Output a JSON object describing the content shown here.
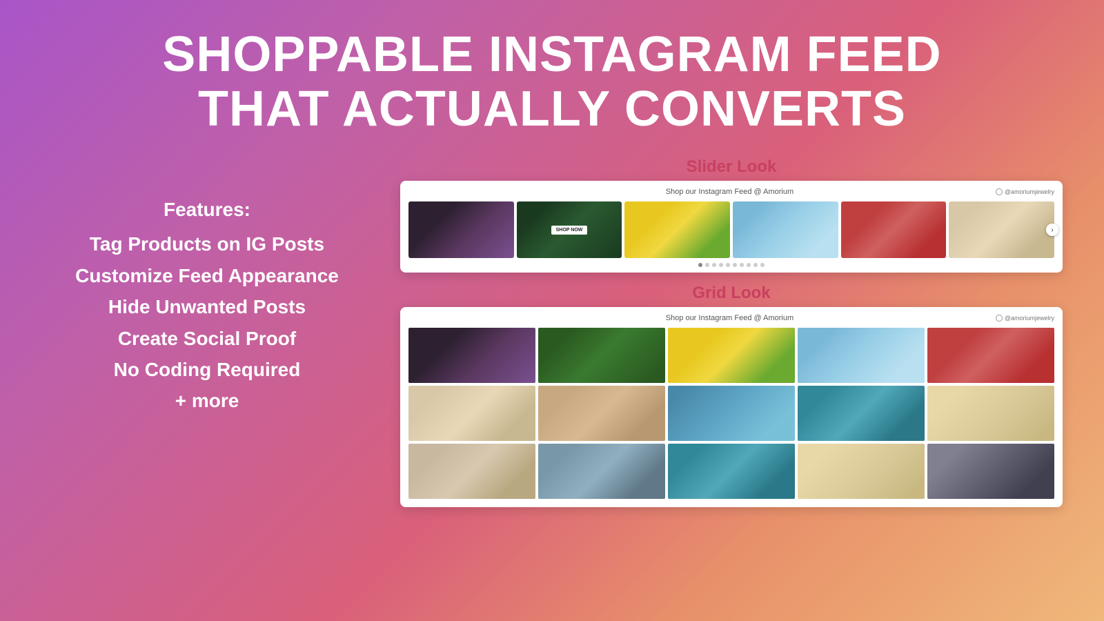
{
  "headline": {
    "line1": "SHOPPABLE INSTAGRAM FEED",
    "line2": "THAT ACTUALLY CONVERTS"
  },
  "features": {
    "label": "Features:",
    "items": [
      "Tag Products on IG Posts",
      "Customize Feed Appearance",
      "Hide Unwanted Posts",
      "Create Social Proof",
      "No Coding Required",
      "+ more"
    ]
  },
  "slider": {
    "label": "Slider Look",
    "header_title": "Shop our Instagram Feed @ Amorium",
    "handle": "@amoriumjewelry",
    "dots_count": 10,
    "active_dot": 0
  },
  "grid": {
    "label": "Grid Look",
    "header_title": "Shop our Instagram Feed @ Amorium",
    "handle": "@amoriumjewelry"
  }
}
